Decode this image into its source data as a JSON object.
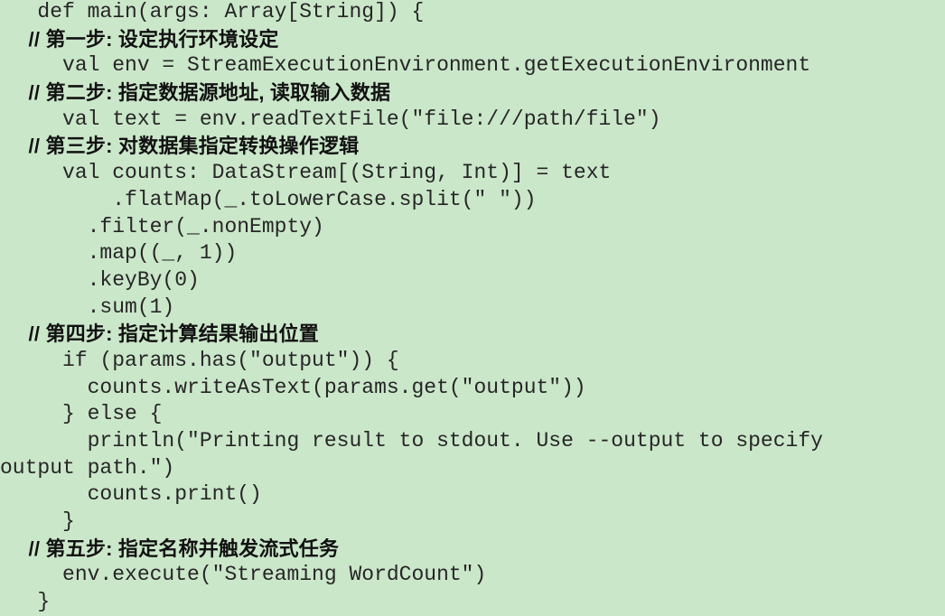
{
  "editor": {
    "background_color": "#cbe7ca",
    "code_text_color": "#262626",
    "comment_text_color": "#111111",
    "language": "scala",
    "font_size_px": 23,
    "line_height_px": 29.7
  },
  "code": {
    "lines": [
      {
        "id": "line-1",
        "kind": "code",
        "text": "   def main(args: Array[String]) {"
      },
      {
        "id": "line-2",
        "kind": "comment",
        "text": "     // 第一步: 设定执行环境设定"
      },
      {
        "id": "line-3",
        "kind": "code",
        "text": "     val env = StreamExecutionEnvironment.getExecutionEnvironment"
      },
      {
        "id": "line-4",
        "kind": "comment",
        "text": "     // 第二步: 指定数据源地址, 读取输入数据"
      },
      {
        "id": "line-5",
        "kind": "code",
        "text": "     val text = env.readTextFile(\"file:///path/file\")"
      },
      {
        "id": "line-6",
        "kind": "comment",
        "text": "     // 第三步: 对数据集指定转换操作逻辑"
      },
      {
        "id": "line-7",
        "kind": "code",
        "text": "     val counts: DataStream[(String, Int)] = text"
      },
      {
        "id": "line-8",
        "kind": "code",
        "text": "         .flatMap(_.toLowerCase.split(\" \"))"
      },
      {
        "id": "line-9",
        "kind": "code",
        "text": "       .filter(_.nonEmpty)"
      },
      {
        "id": "line-10",
        "kind": "code",
        "text": "       .map((_, 1))"
      },
      {
        "id": "line-11",
        "kind": "code",
        "text": "       .keyBy(0)"
      },
      {
        "id": "line-12",
        "kind": "code",
        "text": "       .sum(1)"
      },
      {
        "id": "line-13",
        "kind": "comment",
        "text": "     // 第四步: 指定计算结果输出位置"
      },
      {
        "id": "line-14",
        "kind": "code",
        "text": "     if (params.has(\"output\")) {"
      },
      {
        "id": "line-15",
        "kind": "code",
        "text": "       counts.writeAsText(params.get(\"output\"))"
      },
      {
        "id": "line-16",
        "kind": "code",
        "text": "     } else {"
      },
      {
        "id": "line-17",
        "kind": "code",
        "text": "       println(\"Printing result to stdout. Use --output to specify"
      },
      {
        "id": "line-18",
        "kind": "code",
        "text": "output path.\")"
      },
      {
        "id": "line-19",
        "kind": "code",
        "text": "       counts.print()"
      },
      {
        "id": "line-20",
        "kind": "code",
        "text": "     }"
      },
      {
        "id": "line-21",
        "kind": "comment",
        "text": "     // 第五步: 指定名称并触发流式任务"
      },
      {
        "id": "line-22",
        "kind": "code",
        "text": "     env.execute(\"Streaming WordCount\")"
      },
      {
        "id": "line-23",
        "kind": "code",
        "text": "   }"
      }
    ]
  }
}
